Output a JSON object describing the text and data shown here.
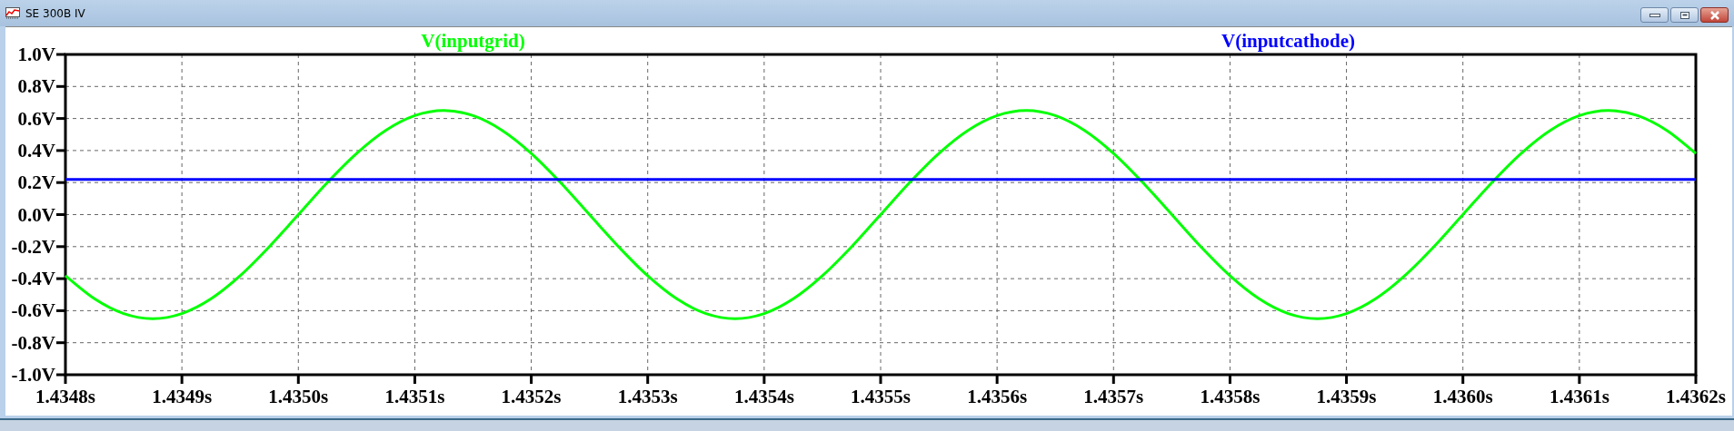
{
  "window": {
    "title": "SE 300B IV"
  },
  "plot": {
    "chart_data": {
      "type": "line",
      "x": [
        1.4348,
        1.434825,
        1.43485,
        1.434875,
        1.4349,
        1.434925,
        1.43495,
        1.434975,
        1.435,
        1.435025,
        1.43505,
        1.435075,
        1.4351,
        1.435125,
        1.43515,
        1.435175,
        1.4352,
        1.435225,
        1.43525,
        1.435275,
        1.4353,
        1.435325,
        1.43535,
        1.435375,
        1.4354,
        1.435425,
        1.43545,
        1.435475,
        1.4355,
        1.435525,
        1.43555,
        1.435575,
        1.4356,
        1.435625,
        1.43565,
        1.435675,
        1.4357,
        1.435725,
        1.43575,
        1.435775,
        1.4358,
        1.435825,
        1.43585,
        1.435875,
        1.4359,
        1.435925,
        1.43595,
        1.435975,
        1.436,
        1.436025,
        1.43605,
        1.436075,
        1.4361,
        1.436125,
        1.43615,
        1.436175,
        1.4362
      ],
      "series": [
        {
          "name": "V(inputgrid)",
          "color": "#00ff00",
          "values": [
            -0.382,
            -0.526,
            -0.618,
            -0.65,
            -0.618,
            -0.526,
            -0.382,
            -0.201,
            0,
            0.201,
            0.382,
            0.526,
            0.618,
            0.65,
            0.618,
            0.526,
            0.382,
            0.201,
            0,
            -0.201,
            -0.382,
            -0.526,
            -0.618,
            -0.65,
            -0.618,
            -0.526,
            -0.382,
            -0.201,
            0,
            0.201,
            0.382,
            0.526,
            0.618,
            0.65,
            0.618,
            0.526,
            0.382,
            0.201,
            0,
            -0.201,
            -0.382,
            -0.526,
            -0.618,
            -0.65,
            -0.618,
            -0.526,
            -0.382,
            -0.201,
            0,
            0.201,
            0.382,
            0.526,
            0.618,
            0.65,
            0.618,
            0.526,
            0.382
          ]
        },
        {
          "name": "V(inputcathode)",
          "color": "#0000ff",
          "values": [
            0.22,
            0.22,
            0.22,
            0.22,
            0.22,
            0.22,
            0.22,
            0.22,
            0.22,
            0.22,
            0.22,
            0.22,
            0.22,
            0.22,
            0.22,
            0.22,
            0.22,
            0.22,
            0.22,
            0.22,
            0.22,
            0.22,
            0.22,
            0.22,
            0.22,
            0.22,
            0.22,
            0.22,
            0.22,
            0.22,
            0.22,
            0.22,
            0.22,
            0.22,
            0.22,
            0.22,
            0.22,
            0.22,
            0.22,
            0.22,
            0.22,
            0.22,
            0.22,
            0.22,
            0.22,
            0.22,
            0.22,
            0.22,
            0.22,
            0.22,
            0.22,
            0.22,
            0.22,
            0.22,
            0.22,
            0.22,
            0.22
          ]
        }
      ],
      "grid": true,
      "xlim": [
        1.4348,
        1.4362
      ],
      "ylim": [
        -1.0,
        1.0
      ],
      "xticks": [
        {
          "value": 1.4348,
          "label": "1.4348s"
        },
        {
          "value": 1.4349,
          "label": "1.4349s"
        },
        {
          "value": 1.435,
          "label": "1.4350s"
        },
        {
          "value": 1.4351,
          "label": "1.4351s"
        },
        {
          "value": 1.4352,
          "label": "1.4352s"
        },
        {
          "value": 1.4353,
          "label": "1.4353s"
        },
        {
          "value": 1.4354,
          "label": "1.4354s"
        },
        {
          "value": 1.4355,
          "label": "1.4355s"
        },
        {
          "value": 1.4356,
          "label": "1.4356s"
        },
        {
          "value": 1.4357,
          "label": "1.4357s"
        },
        {
          "value": 1.4358,
          "label": "1.4358s"
        },
        {
          "value": 1.4359,
          "label": "1.4359s"
        },
        {
          "value": 1.436,
          "label": "1.4360s"
        },
        {
          "value": 1.4361,
          "label": "1.4361s"
        },
        {
          "value": 1.4362,
          "label": "1.4362s"
        }
      ],
      "yticks": [
        {
          "value": 1.0,
          "label": "1.0V"
        },
        {
          "value": 0.8,
          "label": "0.8V"
        },
        {
          "value": 0.6,
          "label": "0.6V"
        },
        {
          "value": 0.4,
          "label": "0.4V"
        },
        {
          "value": 0.2,
          "label": "0.2V"
        },
        {
          "value": 0.0,
          "label": "0.0V"
        },
        {
          "value": -0.2,
          "label": "-0.2V"
        },
        {
          "value": -0.4,
          "label": "-0.4V"
        },
        {
          "value": -0.6,
          "label": "-0.6V"
        },
        {
          "value": -0.8,
          "label": "-0.8V"
        },
        {
          "value": -1.0,
          "label": "-1.0V"
        }
      ]
    }
  }
}
